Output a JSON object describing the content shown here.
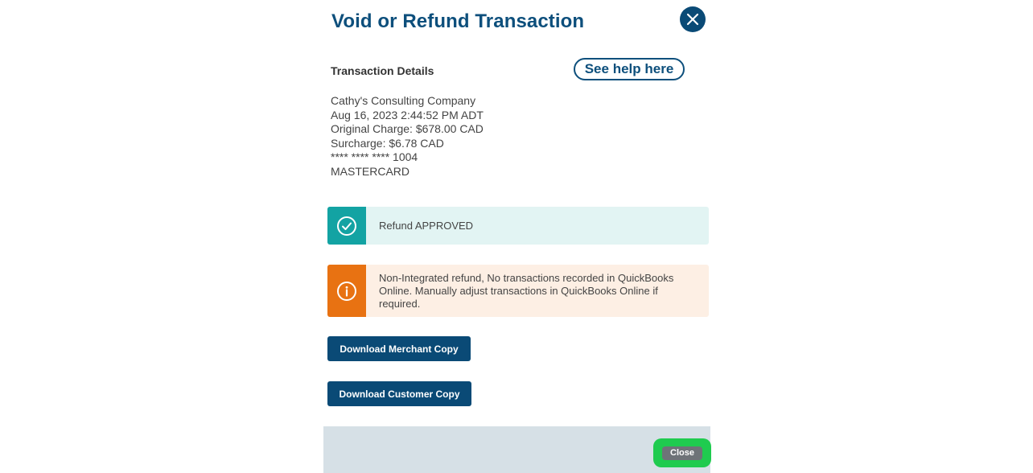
{
  "dialog": {
    "title": "Void or Refund Transaction",
    "help_button": "See help here",
    "section_label": "Transaction Details"
  },
  "transaction": {
    "lines": [
      "Cathy's Consulting Company",
      "Aug 16, 2023 2:44:52 PM ADT",
      "Original Charge: $678.00 CAD",
      "Surcharge: $6.78 CAD",
      "**** **** **** 1004",
      "MASTERCARD"
    ]
  },
  "alerts": {
    "success": {
      "message": "Refund APPROVED",
      "icon": "check-circle-icon",
      "color": "#13a3a3"
    },
    "warning": {
      "message": "Non-Integrated refund, No transactions recorded in QuickBooks Online. Manually adjust transactions in QuickBooks Online if required.",
      "icon": "info-circle-icon",
      "color": "#e87212"
    }
  },
  "buttons": {
    "download_merchant": "Download Merchant Copy",
    "download_customer": "Download Customer Copy",
    "close": "Close"
  },
  "colors": {
    "primary": "#0a4a76",
    "footer": "#d6e0e6",
    "highlight": "#1fcb4f"
  }
}
